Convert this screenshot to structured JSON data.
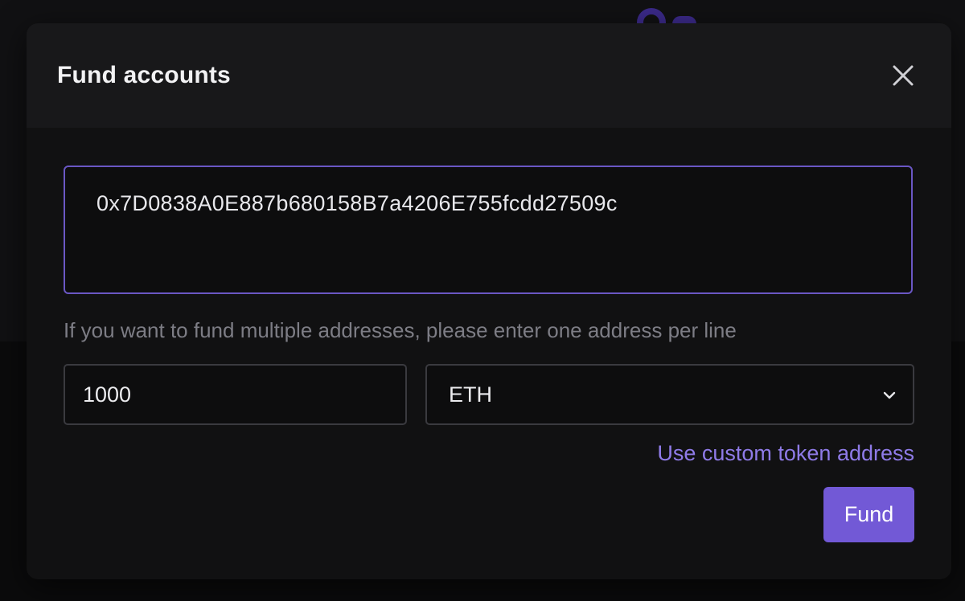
{
  "dialog": {
    "title": "Fund accounts",
    "addresses_value": "0x7D0838A0E887b680158B7a4206E755fcdd27509c",
    "helper_text": "If you want to fund multiple addresses, please enter one address per line",
    "amount_value": "1000",
    "token_selected": "ETH",
    "custom_token_link": "Use custom token address",
    "fund_label": "Fund"
  },
  "icons": {
    "close": "close-icon",
    "dropdown": "chevron-down-icon",
    "background_logo": "brand-logo-icon"
  },
  "colors": {
    "accent": "#7259d6",
    "link": "#8f7be8",
    "focus_border": "#6a57c4"
  }
}
